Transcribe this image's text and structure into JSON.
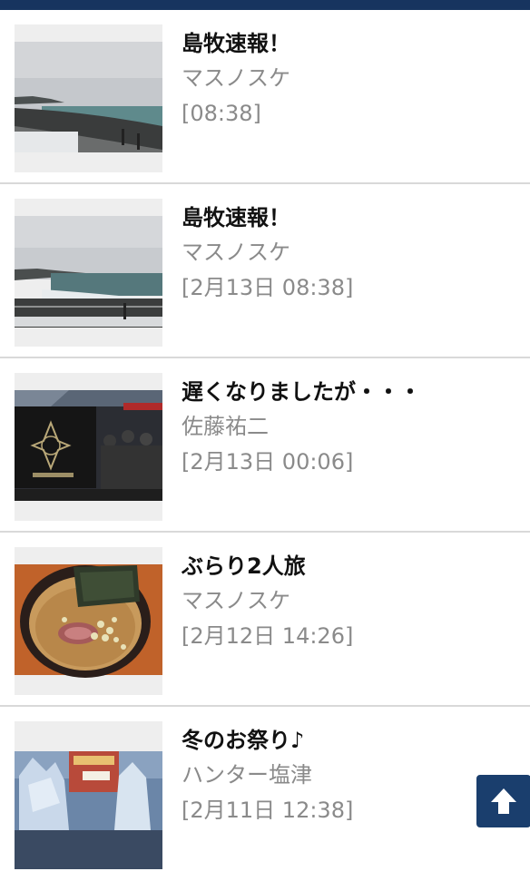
{
  "posts": [
    {
      "title": "島牧速報！",
      "author": "マスノスケ",
      "date": "[08:38]",
      "image": "snowy-coast-photo"
    },
    {
      "title": "島牧速報！",
      "author": "マスノスケ",
      "date": "[2月13日 08:38]",
      "image": "coast-waves-photo"
    },
    {
      "title": "遅くなりましたが・・・",
      "author": "佐藤祐二",
      "date": "[2月13日 00:06]",
      "image": "exhibition-booth-photo"
    },
    {
      "title": "ぶらり2人旅",
      "author": "マスノスケ",
      "date": "[2月12日 14:26]",
      "image": "ramen-bowl-photo"
    },
    {
      "title": "冬のお祭り♪",
      "author": "ハンター塩津",
      "date": "[2月11日 12:38]",
      "image": "snow-festival-photo"
    }
  ],
  "back_to_top": {
    "icon": "arrow-up-icon"
  },
  "colors": {
    "header": "#17345f",
    "button": "#1a3e6d",
    "meta_text": "#8a8a8a"
  }
}
